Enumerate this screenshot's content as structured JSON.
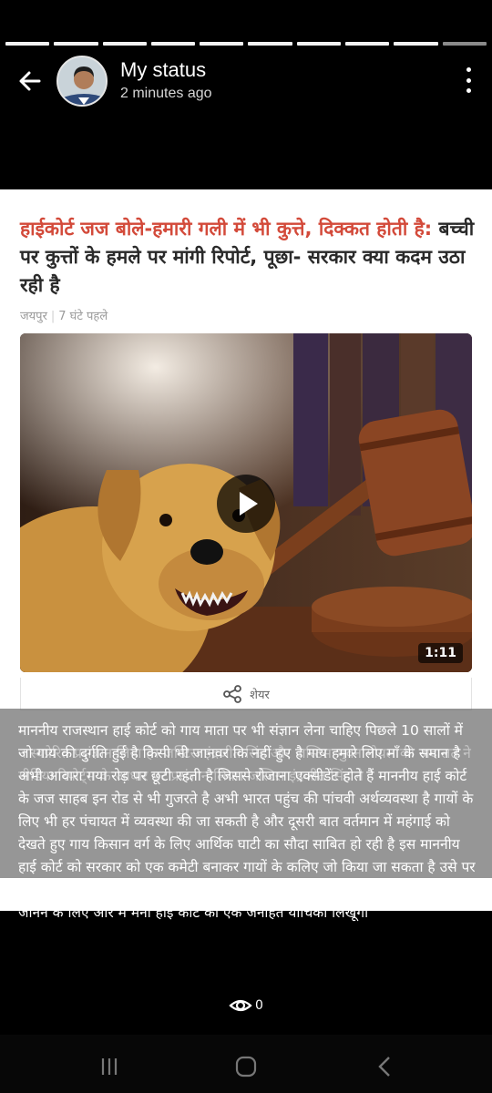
{
  "status": {
    "title": "My status",
    "time": "2 minutes ago",
    "segments": 10,
    "current_segment": 10,
    "views": "0"
  },
  "article": {
    "headline_red": "हाईकोर्ट जज बोले-हमारी गली में भी कुत्ते, दिक्कत होती है:",
    "headline_rest": " बच्ची पर कुत्तों के हमले पर मांगी रिपोर्ट, पूछा- सरकार क्या कदम उठा रही है",
    "location": "जयपुर",
    "time": "7 घंटे पहले",
    "video_duration": "1:11",
    "share_label": "शेयर",
    "background_text": "न स्वप्रेरित प्रसंज्ञान लिया है। जस्टिस इंद्रजीत सिंह और जस्टिस भुवन गोयल की अदालत ने मीडिया रिपोर्ट्स के आधार पर प्रसंज्ञान लिया। जस्टिस इंद्रजीत सिंह ने"
  },
  "caption": "माननीय राजस्थान हाई कोर्ट को गाय माता पर भी संज्ञान लेना चाहिए पिछले 10 सालों में जो गाय की दुर्गति हुई है किसी भी जानवर कि नहीं हुए है गाय हमारे लिए मॉं के समान है अभी आवारा गया रोड़ पर छूटी रहती है जिससे रोजाना एक्सीडेंट होते हैं माननीय हाई कोर्ट के जज साहब इन रोड से भी गुजरते है अभी भारत पहुंच की पांचवी अर्थव्यवस्था है गायों के लिए भी हर पंचायत में व्यवस्था की जा सकती है और दूसरी बात वर्तमान में महंगाई को देखते हुए गाय किसान  वर्ग के लिए आर्थिक घाटी का सौदा साबित हो रही है इस माननीय हाई कोर्ट को सरकार को एक कमेटी बनाकर गायों के कलिए जो किया जा सकता है उसे पर रिपोर्ट लेनी चाहिए कितनी संवेदना मानव जाति की उतनी इतनी संवेदना अपने धरती पर नहीं जानने के लिए और मैं मनी हाई कोर्ट को एक जनहित याचिका लिखूंगा",
  "colors": {
    "background": "#000000",
    "headline_red": "#d34a3a",
    "overlay": "#6e6e6e"
  },
  "icons": {
    "back": "arrow-left-icon",
    "more": "more-vert-icon",
    "eye": "eye-icon",
    "share": "share-icon",
    "play": "play-icon"
  }
}
